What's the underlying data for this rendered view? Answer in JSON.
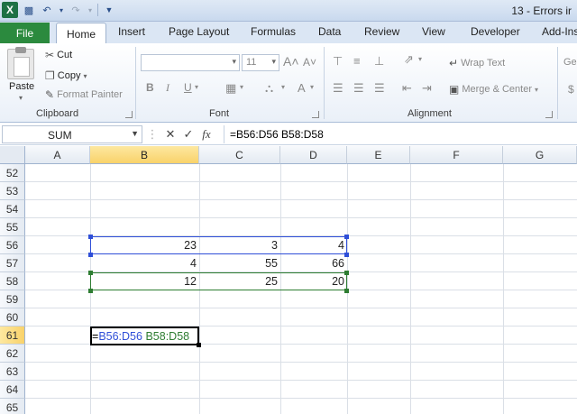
{
  "title_bar": {
    "title": "13 - Errors ir"
  },
  "tabs": [
    "File",
    "Home",
    "Insert",
    "Page Layout",
    "Formulas",
    "Data",
    "Review",
    "View",
    "Developer",
    "Add-Ins"
  ],
  "ribbon": {
    "clipboard": {
      "paste": "Paste",
      "cut": "Cut",
      "copy": "Copy",
      "format_painter": "Format Painter",
      "label": "Clipboard"
    },
    "font": {
      "size": "11",
      "bold": "B",
      "italic": "I",
      "underline": "U",
      "label": "Font"
    },
    "alignment": {
      "wrap_text": "Wrap Text",
      "merge_center": "Merge & Center",
      "label": "Alignment"
    },
    "number": {
      "format": "Ge",
      "currency": "$"
    }
  },
  "formula_bar": {
    "name_box": "SUM",
    "formula": "=B56:D56 B58:D58"
  },
  "columns": [
    "A",
    "B",
    "C",
    "D",
    "E",
    "F",
    "G"
  ],
  "rows": [
    "52",
    "53",
    "54",
    "55",
    "56",
    "57",
    "58",
    "59",
    "60",
    "61",
    "62",
    "63",
    "64",
    "65"
  ],
  "cells": {
    "r56": [
      "23",
      "3",
      "4"
    ],
    "r57": [
      "4",
      "55",
      "66"
    ],
    "r58": [
      "12",
      "25",
      "20"
    ]
  },
  "editing": {
    "eq": "=",
    "ref1": "B56:D56",
    "space": " ",
    "ref2": "B58:D58"
  },
  "colors": {
    "ref1": "#2f4fd8",
    "ref2": "#2e7d32",
    "selected_header": "#f9d26a",
    "file_tab": "#2b8a3e"
  }
}
